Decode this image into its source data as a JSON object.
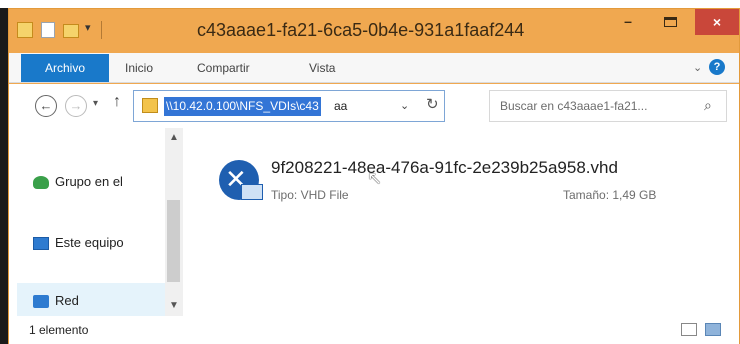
{
  "window": {
    "title": "c43aaae1-fa21-6ca5-0b4e-931a1faaf244",
    "buttons": {
      "minimize": "–",
      "close": "×"
    }
  },
  "ribbon": {
    "tabs": [
      "Archivo",
      "Inicio",
      "Compartir",
      "Vista"
    ],
    "expand": "⌄",
    "help": "?"
  },
  "navigation": {
    "back": "←",
    "forward": "→",
    "recent": "▾",
    "up": "↑",
    "refresh": "↻"
  },
  "address": {
    "selected_text": "\\\\10.42.0.100\\NFS_VDIs\\c43",
    "rest_text": "aa",
    "dropdown": "⌄"
  },
  "search": {
    "placeholder": "Buscar en c43aaae1-fa21...",
    "icon": "⌕"
  },
  "nav_pane": {
    "items": [
      {
        "label": "Grupo en el",
        "icon": "homegroup-icon"
      },
      {
        "label": "Este equipo",
        "icon": "computer-icon"
      },
      {
        "label": "Red",
        "icon": "network-icon",
        "selected": true
      }
    ]
  },
  "file": {
    "name": "9f208221-48ea-476a-91fc-2e239b25a958.vhd",
    "type": "Tipo: VHD File",
    "size": "Tamaño: 1,49 GB",
    "icon": "vhd-file-icon"
  },
  "status": {
    "count": "1 elemento"
  },
  "colors": {
    "titlebar": "#f0a850",
    "file_tab": "#1979ca",
    "close_button": "#c9473a",
    "selection": "#3375d6"
  }
}
